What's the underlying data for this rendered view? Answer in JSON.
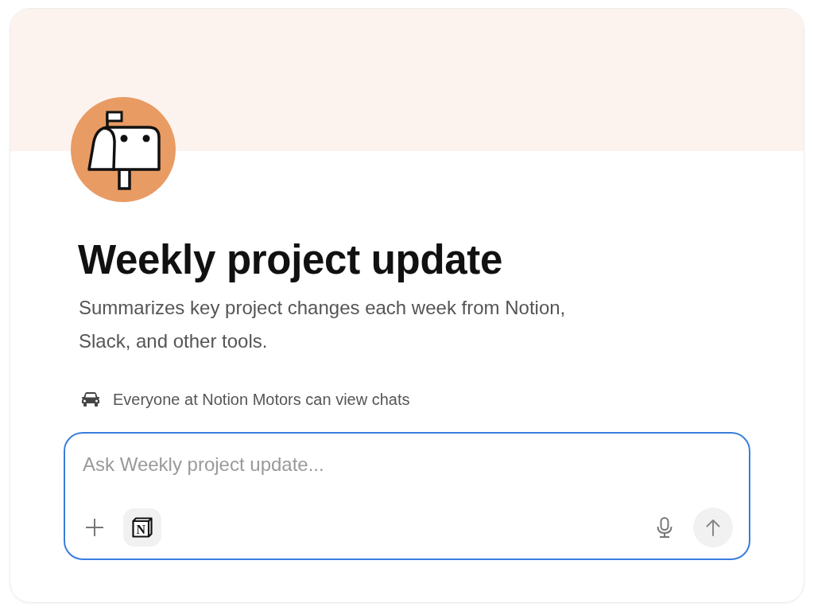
{
  "agent": {
    "title": "Weekly project update",
    "description": "Summarizes key project changes each week from Notion, Slack, and other tools."
  },
  "visibility": {
    "text": "Everyone at Notion Motors can view chats"
  },
  "composer": {
    "placeholder": "Ask Weekly project update...",
    "focused": true,
    "app_logo_letter": "N"
  }
}
